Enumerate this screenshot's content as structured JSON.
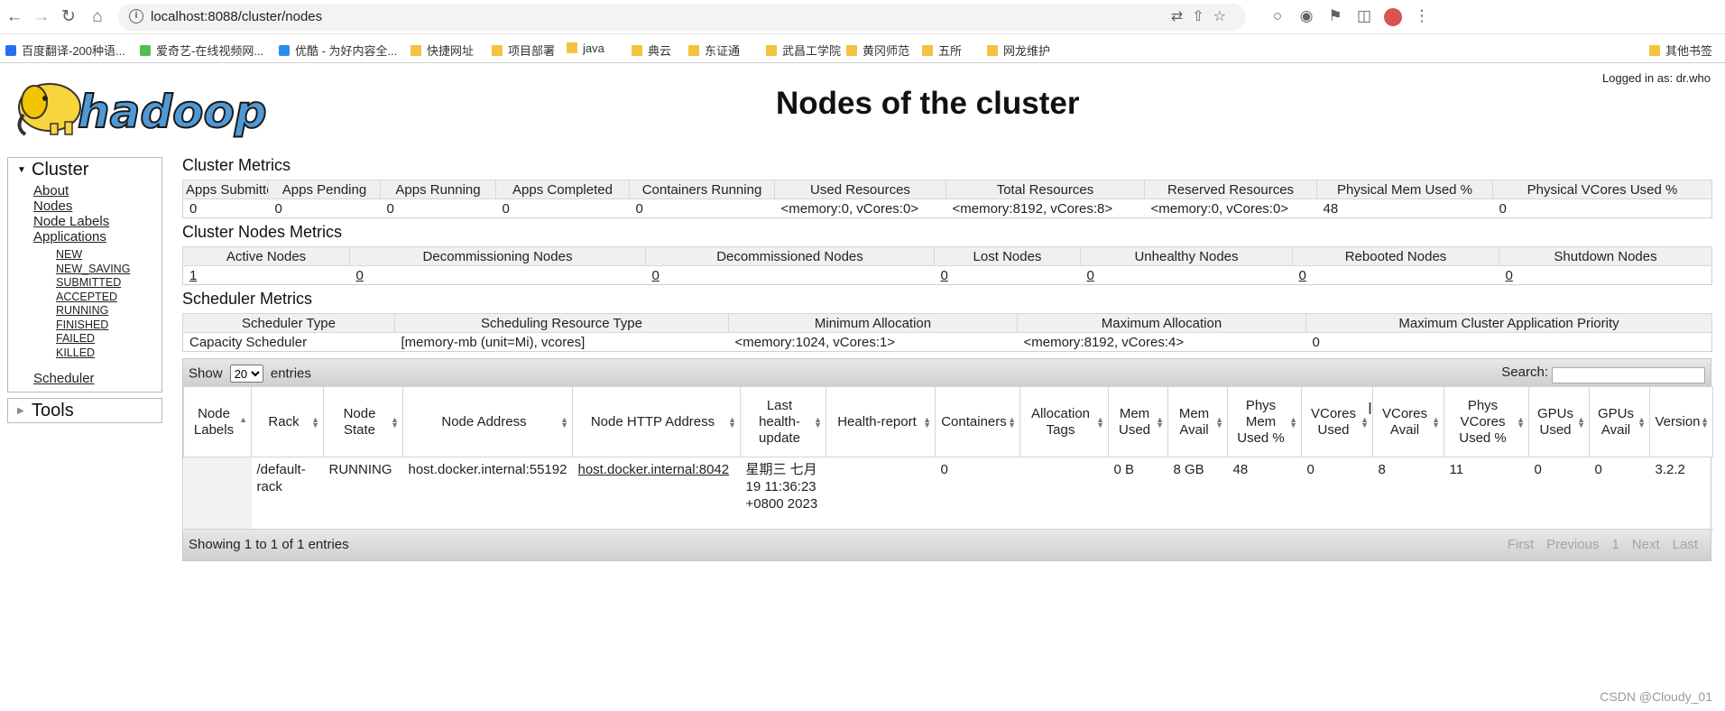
{
  "browser": {
    "url": "localhost:8088/cluster/nodes",
    "bookmarks": [
      {
        "label": "百度翻译-200种语...",
        "color": "#2a6ef0",
        "folder": false
      },
      {
        "label": "爱奇艺-在线视频网...",
        "color": "#4cc04a",
        "folder": false
      },
      {
        "label": "优酷 - 为好内容全...",
        "color": "#2d8cf0",
        "folder": false
      },
      {
        "label": "快捷网址",
        "folder": true
      },
      {
        "label": "项目部署",
        "folder": true
      },
      {
        "label": "java",
        "folder": true
      },
      {
        "label": "典云",
        "folder": true
      },
      {
        "label": "东证通",
        "folder": true
      },
      {
        "label": "武昌工学院",
        "folder": true
      },
      {
        "label": "黄冈师范",
        "folder": true
      },
      {
        "label": "五所",
        "folder": true
      },
      {
        "label": "网龙维护",
        "folder": true
      }
    ],
    "other_bookmarks": "其他书签"
  },
  "header": {
    "logged_in": "Logged in as: dr.who",
    "title": "Nodes of the cluster",
    "logo_text": "hadoop"
  },
  "sidebar": {
    "cluster_label": "Cluster",
    "links": [
      "About",
      "Nodes",
      "Node Labels",
      "Applications"
    ],
    "app_states": [
      "NEW",
      "NEW_SAVING",
      "SUBMITTED",
      "ACCEPTED",
      "RUNNING",
      "FINISHED",
      "FAILED",
      "KILLED"
    ],
    "scheduler": "Scheduler",
    "tools_label": "Tools"
  },
  "cluster_metrics": {
    "title": "Cluster Metrics",
    "headers": [
      "Apps Submitted",
      "Apps Pending",
      "Apps Running",
      "Apps Completed",
      "Containers Running",
      "Used Resources",
      "Total Resources",
      "Reserved Resources",
      "Physical Mem Used %",
      "Physical VCores Used %"
    ],
    "values": [
      "0",
      "0",
      "0",
      "0",
      "0",
      "<memory:0, vCores:0>",
      "<memory:8192, vCores:8>",
      "<memory:0, vCores:0>",
      "48",
      "0"
    ]
  },
  "node_metrics": {
    "title": "Cluster Nodes Metrics",
    "headers": [
      "Active Nodes",
      "Decommissioning Nodes",
      "Decommissioned Nodes",
      "Lost Nodes",
      "Unhealthy Nodes",
      "Rebooted Nodes",
      "Shutdown Nodes"
    ],
    "values": [
      "1",
      "0",
      "0",
      "0",
      "0",
      "0",
      "0"
    ]
  },
  "scheduler_metrics": {
    "title": "Scheduler Metrics",
    "headers": [
      "Scheduler Type",
      "Scheduling Resource Type",
      "Minimum Allocation",
      "Maximum Allocation",
      "Maximum Cluster Application Priority"
    ],
    "values": [
      "Capacity Scheduler",
      "[memory-mb (unit=Mi), vcores]",
      "<memory:1024, vCores:1>",
      "<memory:8192, vCores:4>",
      "0"
    ]
  },
  "nodes_table": {
    "show_label": "Show",
    "entries_label": "entries",
    "page_size": "20",
    "search_label": "Search:",
    "headers": [
      "Node Labels",
      "Rack",
      "Node State",
      "Node Address",
      "Node HTTP Address",
      "Last health-update",
      "Health-report",
      "Containers",
      "Allocation Tags",
      "Mem Used",
      "Mem Avail",
      "Phys Mem Used %",
      "VCores Used",
      "VCores Avail",
      "Phys VCores Used %",
      "GPUs Used",
      "GPUs Avail",
      "Version"
    ],
    "rows": [
      [
        "",
        "/default-rack",
        "RUNNING",
        "host.docker.internal:55192",
        "host.docker.internal:8042",
        "星期三 七月 19 11:36:23 +0800 2023",
        "",
        "0",
        "",
        "0 B",
        "8 GB",
        "48",
        "0",
        "8",
        "11",
        "0",
        "0",
        "3.2.2"
      ]
    ],
    "info": "Showing 1 to 1 of 1 entries",
    "pager": [
      "First",
      "Previous",
      "1",
      "Next",
      "Last"
    ]
  },
  "watermark": "CSDN @Cloudy_01"
}
